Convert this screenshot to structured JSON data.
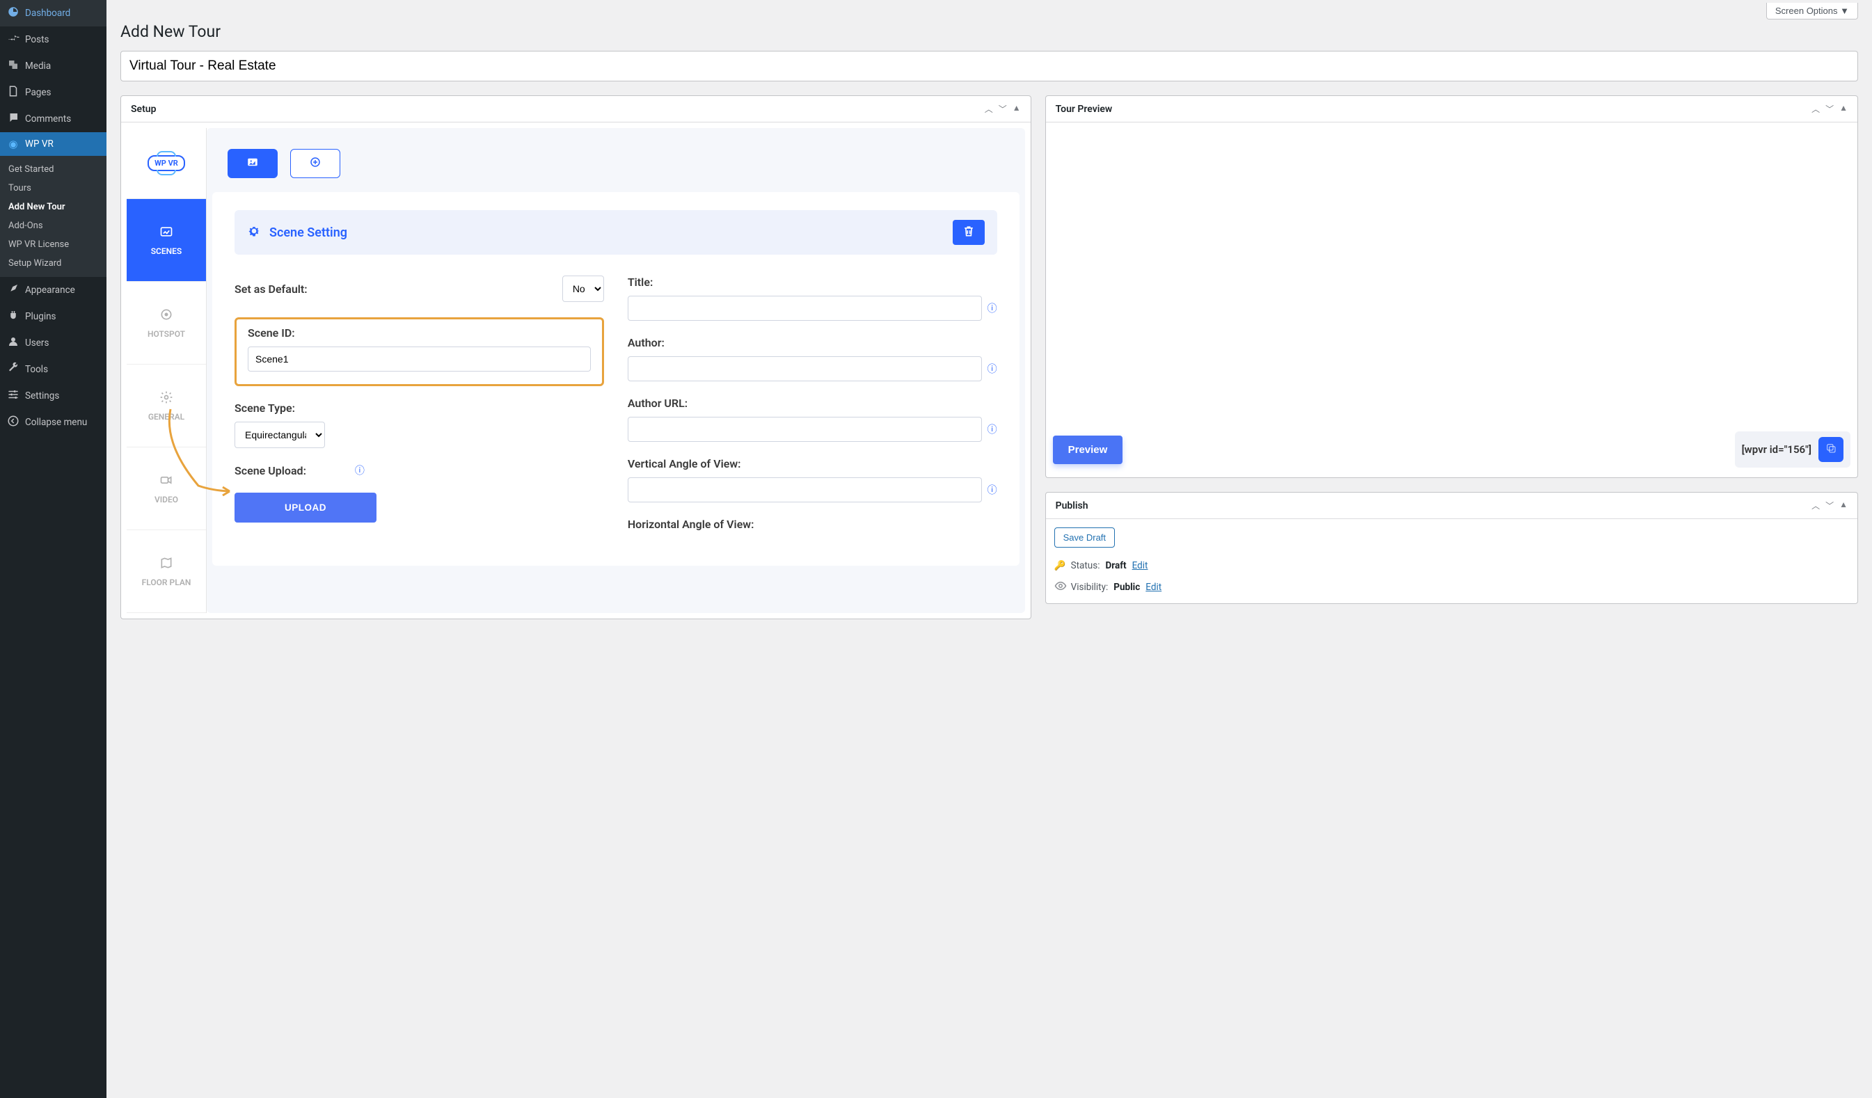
{
  "screenOptions": "Screen Options",
  "pageTitle": "Add New Tour",
  "titleInput": "Virtual Tour - Real Estate",
  "sidebar": {
    "items": [
      {
        "icon": "dashboard",
        "label": "Dashboard"
      },
      {
        "icon": "pin",
        "label": "Posts"
      },
      {
        "icon": "media",
        "label": "Media"
      },
      {
        "icon": "pages",
        "label": "Pages"
      },
      {
        "icon": "comment",
        "label": "Comments"
      },
      {
        "icon": "wpvr",
        "label": "WP VR"
      },
      {
        "icon": "appearance",
        "label": "Appearance"
      },
      {
        "icon": "plugins",
        "label": "Plugins"
      },
      {
        "icon": "users",
        "label": "Users"
      },
      {
        "icon": "tools",
        "label": "Tools"
      },
      {
        "icon": "settings",
        "label": "Settings"
      },
      {
        "icon": "collapse",
        "label": "Collapse menu"
      }
    ],
    "sub": [
      "Get Started",
      "Tours",
      "Add New Tour",
      "Add-Ons",
      "WP VR License",
      "Setup Wizard"
    ]
  },
  "setup": {
    "heading": "Setup",
    "logoText": "WP VR",
    "tabs": [
      "SCENES",
      "HOTSPOT",
      "GENERAL",
      "VIDEO",
      "FLOOR PLAN"
    ],
    "sceneSetting": "Scene Setting",
    "setDefaultLabel": "Set as Default:",
    "setDefaultValue": "No",
    "sceneIdLabel": "Scene ID:",
    "sceneIdValue": "Scene1",
    "sceneTypeLabel": "Scene Type:",
    "sceneTypeValue": "Equirectangular",
    "sceneUploadLabel": "Scene Upload:",
    "uploadBtn": "UPLOAD",
    "titleLabel": "Title:",
    "authorLabel": "Author:",
    "authorUrlLabel": "Author URL:",
    "verticalLabel": "Vertical Angle of View:",
    "horizontalLabel": "Horizontal Angle of View:"
  },
  "tourPreview": {
    "heading": "Tour Preview",
    "previewBtn": "Preview",
    "shortcode": "[wpvr id=\"156\"]"
  },
  "publish": {
    "heading": "Publish",
    "saveDraft": "Save Draft",
    "statusLabel": "Status:",
    "statusValue": "Draft",
    "visibilityLabel": "Visibility:",
    "visibilityValue": "Public",
    "editLabel": "Edit"
  }
}
